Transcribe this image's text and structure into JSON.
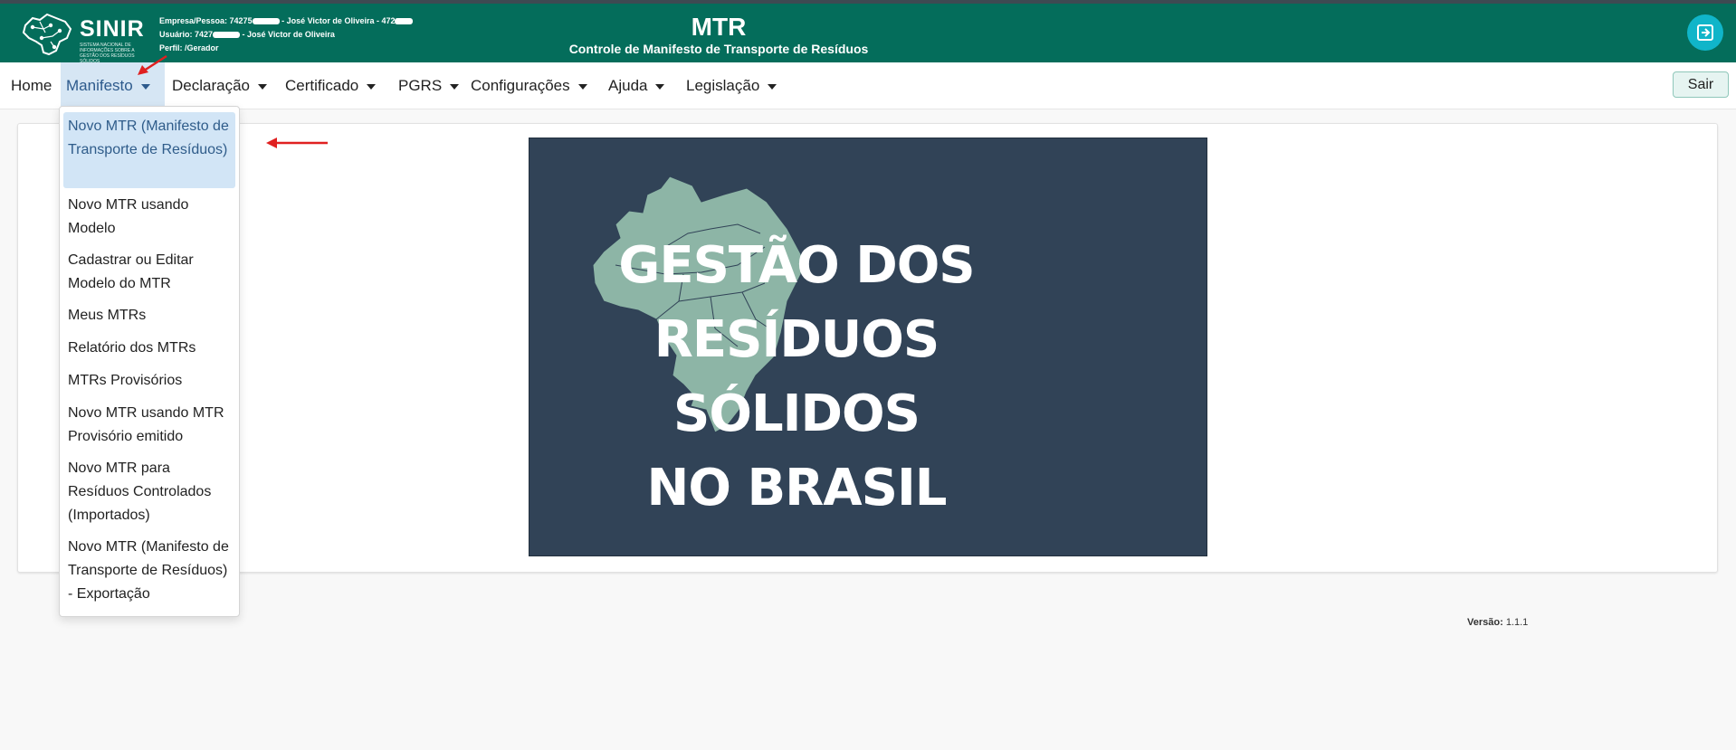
{
  "header": {
    "logo_text": "SINIR",
    "logo_subtitle": "SISTEMA NACIONAL DE INFORMAÇÕES SOBRE A GESTÃO DOS RESÍDUOS SÓLIDOS",
    "empresa_label": "Empresa/Pessoa: 74275",
    "empresa_name": " - José Victor de Oliveira - 472",
    "usuario_label": "Usuário: 7427",
    "usuario_name": " - José Victor de Oliveira",
    "perfil": "Perfil: /Gerador",
    "title": "MTR",
    "subtitle": "Controle de Manifesto de Transporte de Resíduos",
    "logout_icon": "logout-icon"
  },
  "nav": {
    "items": [
      {
        "label": "Home"
      },
      {
        "label": "Manifesto"
      },
      {
        "label": "Declaração"
      },
      {
        "label": "Certificado"
      },
      {
        "label": "PGRS"
      },
      {
        "label": "Configurações"
      },
      {
        "label": "Ajuda"
      },
      {
        "label": "Legislação"
      }
    ],
    "sair": "Sair"
  },
  "dropdown": {
    "items": [
      {
        "label": "Novo MTR (Manifesto de Transporte de Resíduos)"
      },
      {
        "label": "Novo MTR usando Modelo"
      },
      {
        "label": "Cadastrar ou Editar Modelo do MTR"
      },
      {
        "label": "Meus MTRs"
      },
      {
        "label": "Relatório dos MTRs"
      },
      {
        "label": "MTRs Provisórios"
      },
      {
        "label": "Novo MTR usando MTR Provisório emitido"
      },
      {
        "label": "Novo MTR para Resíduos Controlados (Importados)"
      },
      {
        "label": "Novo MTR (Manifesto de Transporte de Resíduos) - Exportação"
      }
    ]
  },
  "banner": {
    "line1": "GESTÃO DOS",
    "line2": "RESÍDUOS SÓLIDOS",
    "line3": "NO BRASIL"
  },
  "footer": {
    "version_label": "Versão:",
    "version_value": "1.1.1"
  },
  "colors": {
    "header_bg": "#046d5b",
    "banner_bg": "#314357",
    "map_fill": "#8db5a6",
    "active_nav": "#d6e6f4",
    "annotation_red": "#e02020"
  }
}
